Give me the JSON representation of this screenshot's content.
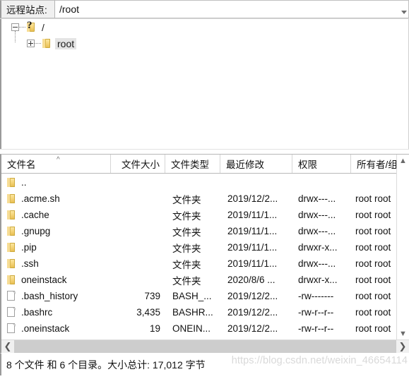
{
  "pathbar": {
    "label": "远程站点:",
    "value": "/root",
    "dropdown_icon": "chevron-down-icon"
  },
  "tree": {
    "nodes": [
      {
        "label": "/",
        "icon": "folder-unknown-icon",
        "expander": "minus",
        "selected": false
      },
      {
        "label": "root",
        "icon": "folder-icon",
        "expander": "plus",
        "selected": true
      }
    ]
  },
  "filelist": {
    "columns": [
      {
        "key": "name",
        "label": "文件名",
        "sort": "asc"
      },
      {
        "key": "size",
        "label": "文件大小"
      },
      {
        "key": "type",
        "label": "文件类型"
      },
      {
        "key": "modified",
        "label": "最近修改"
      },
      {
        "key": "perm",
        "label": "权限"
      },
      {
        "key": "owner",
        "label": "所有者/组"
      }
    ],
    "rows": [
      {
        "icon": "folder-icon",
        "name": "..",
        "size": "",
        "type": "",
        "modified": "",
        "perm": "",
        "owner": ""
      },
      {
        "icon": "folder-icon",
        "name": ".acme.sh",
        "size": "",
        "type": "文件夹",
        "modified": "2019/12/2...",
        "perm": "drwx---...",
        "owner": "root root"
      },
      {
        "icon": "folder-icon",
        "name": ".cache",
        "size": "",
        "type": "文件夹",
        "modified": "2019/11/1...",
        "perm": "drwx---...",
        "owner": "root root"
      },
      {
        "icon": "folder-icon",
        "name": ".gnupg",
        "size": "",
        "type": "文件夹",
        "modified": "2019/11/1...",
        "perm": "drwx---...",
        "owner": "root root"
      },
      {
        "icon": "folder-icon",
        "name": ".pip",
        "size": "",
        "type": "文件夹",
        "modified": "2019/11/1...",
        "perm": "drwxr-x...",
        "owner": "root root"
      },
      {
        "icon": "folder-icon",
        "name": ".ssh",
        "size": "",
        "type": "文件夹",
        "modified": "2019/11/1...",
        "perm": "drwx---...",
        "owner": "root root"
      },
      {
        "icon": "folder-icon",
        "name": "oneinstack",
        "size": "",
        "type": "文件夹",
        "modified": "2020/8/6 ...",
        "perm": "drwxr-x...",
        "owner": "root root"
      },
      {
        "icon": "file-icon",
        "name": ".bash_history",
        "size": "739",
        "type": "BASH_...",
        "modified": "2019/12/2...",
        "perm": "-rw-------",
        "owner": "root root"
      },
      {
        "icon": "file-icon",
        "name": ".bashrc",
        "size": "3,435",
        "type": "BASHR...",
        "modified": "2019/12/2...",
        "perm": "-rw-r--r--",
        "owner": "root root"
      },
      {
        "icon": "file-icon",
        "name": ".oneinstack",
        "size": "19",
        "type": "ONEIN...",
        "modified": "2019/12/2...",
        "perm": "-rw-r--r--",
        "owner": "root root"
      }
    ],
    "hscroll": {
      "left_icon": "chevron-left-icon",
      "right_icon": "chevron-right-icon"
    },
    "vscroll": {
      "up_icon": "chevron-up-icon",
      "down_icon": "chevron-down-icon"
    }
  },
  "statusbar": {
    "text": "8 个文件 和 6 个目录。大小总计: 17,012 字节",
    "watermark": "https://blog.csdn.net/weixin_46654114"
  }
}
